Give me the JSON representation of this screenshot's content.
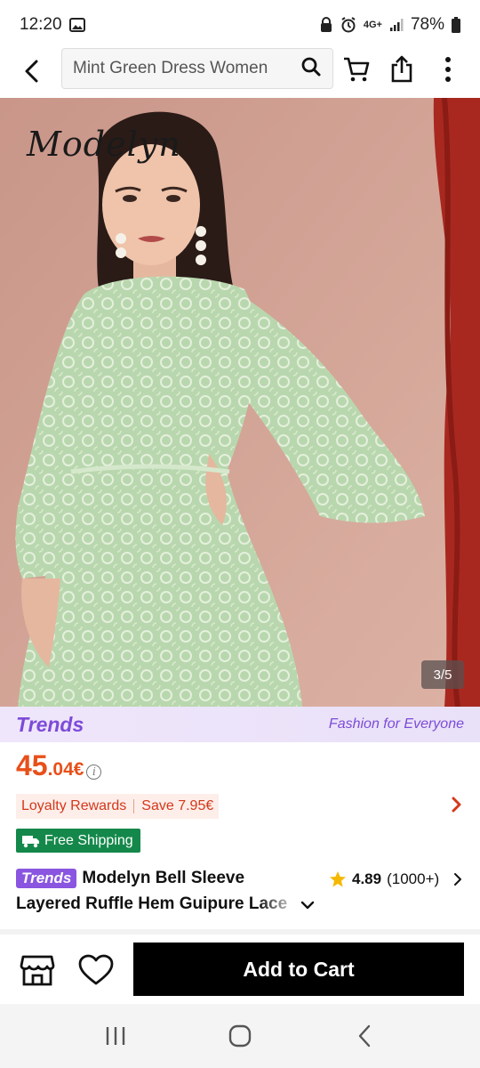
{
  "status_bar": {
    "time": "12:20",
    "network": "4G+",
    "battery": "78%"
  },
  "search": {
    "query": "Mint Green Dress Women"
  },
  "hero": {
    "brand_logo": "Modelyn",
    "counter": "3/5"
  },
  "banner": {
    "logo": "Trends",
    "tagline": "Fashion for Everyone"
  },
  "price": {
    "main": "45",
    "cents": ".04€"
  },
  "loyalty": {
    "label": "Loyalty Rewards",
    "save": "Save 7.95€"
  },
  "shipping": {
    "label": "Free Shipping"
  },
  "product": {
    "tag": "Trends",
    "title_line1": "Modelyn Bell Sleeve",
    "title_line2": "Layered Ruffle Hem Guipure Lace",
    "rating": "4.89",
    "review_count": "(1000+)"
  },
  "actions": {
    "add_to_cart": "Add to Cart"
  },
  "colors": {
    "accent_price": "#e8501a",
    "trends_purple": "#7d4bd8",
    "shipping_green": "#14884a",
    "cart_button": "#000000"
  }
}
